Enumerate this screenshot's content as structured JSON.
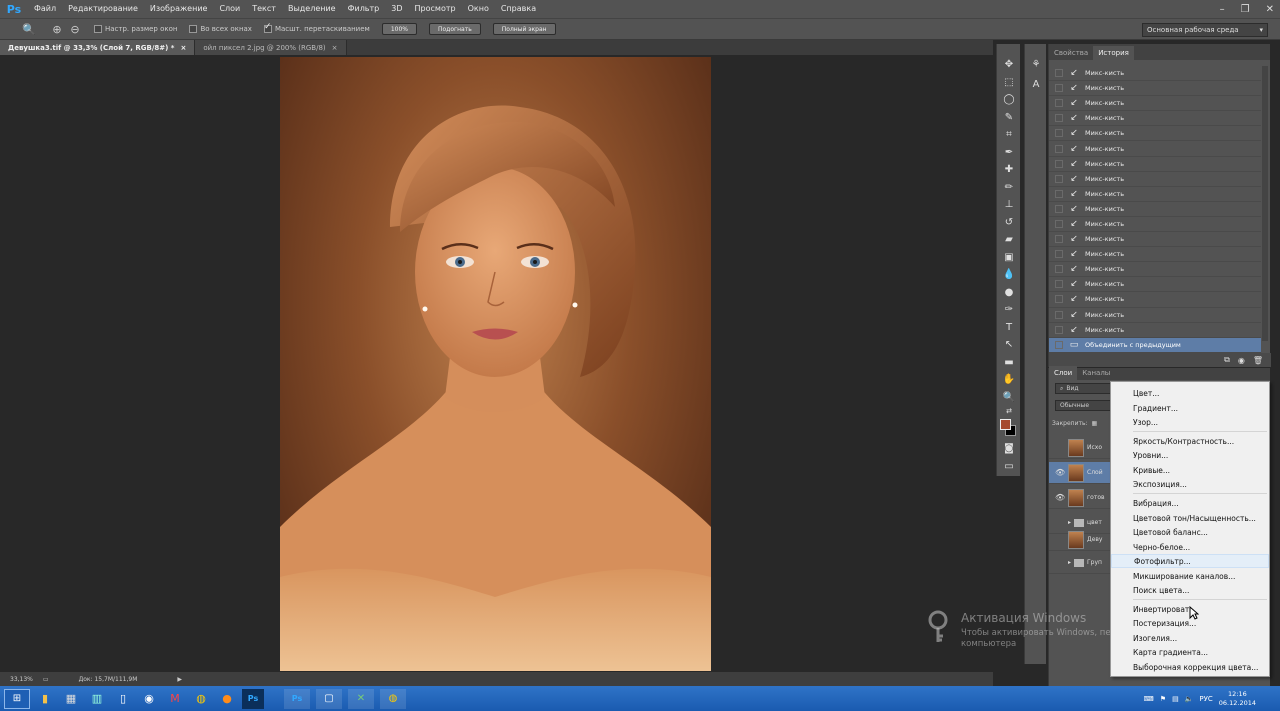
{
  "app": {
    "logo": "Ps",
    "menu": [
      "Файл",
      "Редактирование",
      "Изображение",
      "Слои",
      "Текст",
      "Выделение",
      "Фильтр",
      "3D",
      "Просмотр",
      "Окно",
      "Справка"
    ],
    "window_controls": [
      "–",
      "❐",
      "✕"
    ]
  },
  "options": {
    "resize_windows": "Настр. размер окон",
    "all_windows": "Во всех окнах",
    "scrubby_zoom": "Масшт. перетаскиванием",
    "btn_100": "100%",
    "btn_fit": "Подогнать",
    "btn_fill": "Полный экран",
    "workspace": "Основная рабочая среда"
  },
  "tabs": [
    {
      "label": "Девушка3.tif @ 33,3% (Слой 7, RGB/8#) *",
      "close": "×"
    },
    {
      "label": "ойл пиксел 2.jpg @ 200% (RGB/8)",
      "close": "×"
    }
  ],
  "status": {
    "zoom": "33,13%",
    "doc": "Док: 15,7M/111,9M"
  },
  "history": {
    "tabs": [
      "Свойства",
      "История"
    ],
    "items": [
      "Микс-кисть",
      "Микс-кисть",
      "Микс-кисть",
      "Микс-кисть",
      "Микс-кисть",
      "Микс-кисть",
      "Микс-кисть",
      "Микс-кисть",
      "Микс-кисть",
      "Микс-кисть",
      "Микс-кисть",
      "Микс-кисть",
      "Микс-кисть",
      "Микс-кисть",
      "Микс-кисть",
      "Микс-кисть",
      "Микс-кисть",
      "Микс-кисть"
    ],
    "selected": "Объединить с предыдущим"
  },
  "layers": {
    "tabs": [
      "Слои",
      "Каналы"
    ],
    "filter": "Вид",
    "blend": "Обычные",
    "lock_label": "Закрепить:",
    "rows": [
      {
        "name": "Исхо",
        "eye": ""
      },
      {
        "name": "Слой",
        "eye": "👁"
      },
      {
        "name": "готов",
        "eye": "👁"
      },
      {
        "name": "цвет",
        "eye": ""
      },
      {
        "name": "Деву",
        "eye": ""
      },
      {
        "name": "Груп",
        "eye": ""
      }
    ]
  },
  "context_menu": {
    "items": [
      "Цвет...",
      "Градиент...",
      "Узор...",
      "Яркость/Контрастность...",
      "Уровни...",
      "Кривые...",
      "Экспозиция...",
      "Вибрация...",
      "Цветовой тон/Насыщенность...",
      "Цветовой баланс...",
      "Черно-белое...",
      "Фотофильтр...",
      "Микширование каналов...",
      "Поиск цвета...",
      "Инвертировать",
      "Постеризация...",
      "Изогелия...",
      "Карта градиента...",
      "Выборочная коррекция цвета..."
    ],
    "highlighted": "Фотофильтр..."
  },
  "activation": {
    "title": "Активация Windows",
    "text": "Чтобы активировать Windows, перейдите к параметрам компьютера"
  },
  "tray": {
    "lang": "РУС",
    "time": "12:16",
    "date": "06.12.2014"
  },
  "colors": {
    "accent": "#5e7da7",
    "foreground": "#a64a2d",
    "background": "#000000",
    "taskbar": "#2f73c7"
  }
}
